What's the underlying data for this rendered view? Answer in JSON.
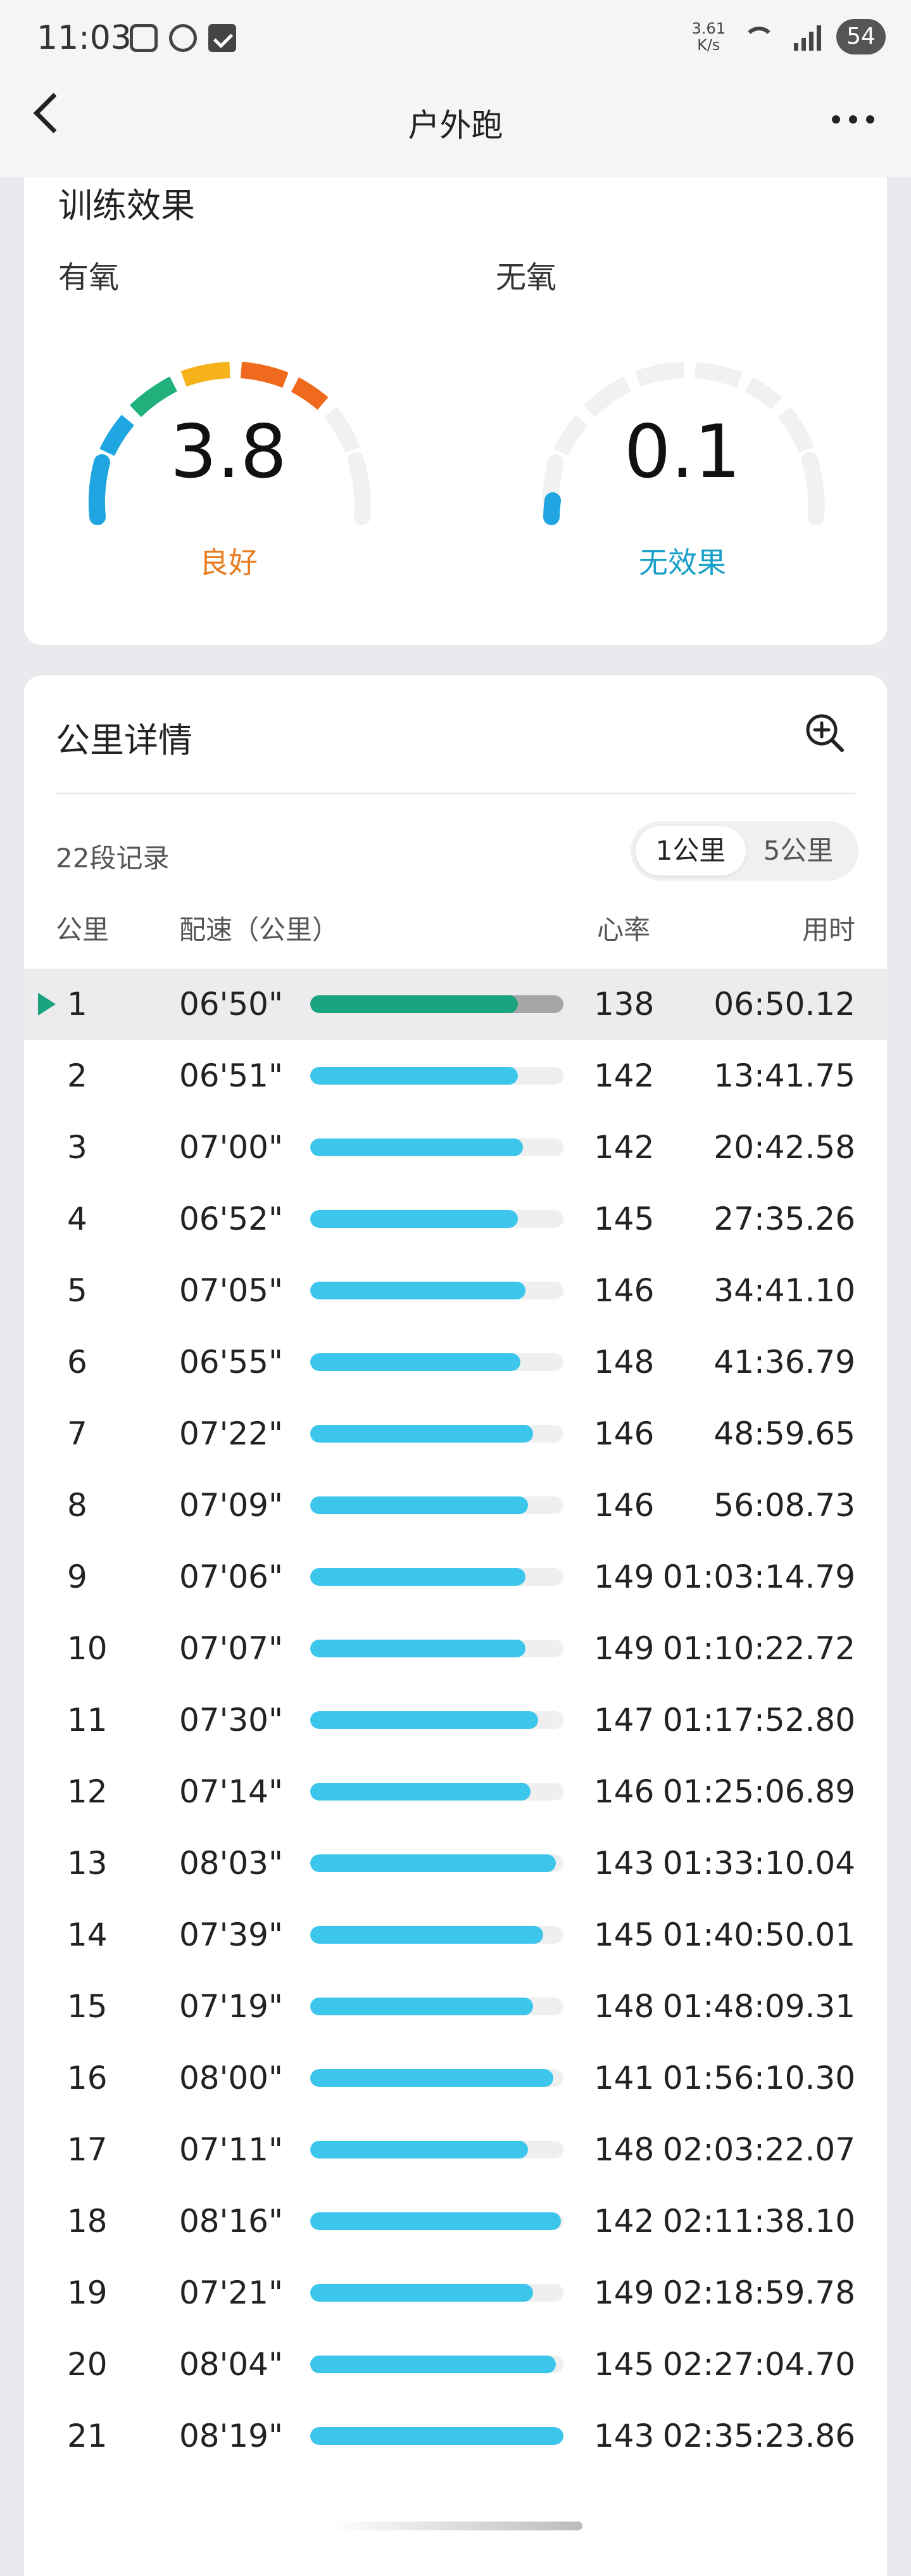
{
  "status": {
    "time": "11:03",
    "speed_value": "3.61",
    "speed_unit": "K/s",
    "battery": "54"
  },
  "header": {
    "title": "户外跑"
  },
  "training": {
    "title": "训练效果",
    "aerobic": {
      "label": "有氧",
      "value": "3.8",
      "status": "良好",
      "status_color": "#e87c1e"
    },
    "anaerobic": {
      "label": "无氧",
      "value": "0.1",
      "status": "无效果",
      "status_color": "#19a0c8"
    }
  },
  "km_details": {
    "title": "公里详情",
    "records": "22段记录",
    "toggle": {
      "active": "1公里",
      "inactive": "5公里"
    },
    "columns": {
      "km": "公里",
      "pace": "配速（公里）",
      "hr": "心率",
      "time": "用时"
    },
    "colors": {
      "first_fill": "#19a37f",
      "fill": "#3cc6ec"
    },
    "rows": [
      {
        "km": "1",
        "pace": "06'50\"",
        "pct": 0.82,
        "hr": "138",
        "time": "06:50.12",
        "selected": true
      },
      {
        "km": "2",
        "pace": "06'51\"",
        "pct": 0.82,
        "hr": "142",
        "time": "13:41.75"
      },
      {
        "km": "3",
        "pace": "07'00\"",
        "pct": 0.84,
        "hr": "142",
        "time": "20:42.58"
      },
      {
        "km": "4",
        "pace": "06'52\"",
        "pct": 0.82,
        "hr": "145",
        "time": "27:35.26"
      },
      {
        "km": "5",
        "pace": "07'05\"",
        "pct": 0.85,
        "hr": "146",
        "time": "34:41.10"
      },
      {
        "km": "6",
        "pace": "06'55\"",
        "pct": 0.83,
        "hr": "148",
        "time": "41:36.79"
      },
      {
        "km": "7",
        "pace": "07'22\"",
        "pct": 0.88,
        "hr": "146",
        "time": "48:59.65"
      },
      {
        "km": "8",
        "pace": "07'09\"",
        "pct": 0.86,
        "hr": "146",
        "time": "56:08.73"
      },
      {
        "km": "9",
        "pace": "07'06\"",
        "pct": 0.85,
        "hr": "149",
        "time": "01:03:14.79"
      },
      {
        "km": "10",
        "pace": "07'07\"",
        "pct": 0.85,
        "hr": "149",
        "time": "01:10:22.72"
      },
      {
        "km": "11",
        "pace": "07'30\"",
        "pct": 0.9,
        "hr": "147",
        "time": "01:17:52.80"
      },
      {
        "km": "12",
        "pace": "07'14\"",
        "pct": 0.87,
        "hr": "146",
        "time": "01:25:06.89"
      },
      {
        "km": "13",
        "pace": "08'03\"",
        "pct": 0.97,
        "hr": "143",
        "time": "01:33:10.04"
      },
      {
        "km": "14",
        "pace": "07'39\"",
        "pct": 0.92,
        "hr": "145",
        "time": "01:40:50.01"
      },
      {
        "km": "15",
        "pace": "07'19\"",
        "pct": 0.88,
        "hr": "148",
        "time": "01:48:09.31"
      },
      {
        "km": "16",
        "pace": "08'00\"",
        "pct": 0.96,
        "hr": "141",
        "time": "01:56:10.30"
      },
      {
        "km": "17",
        "pace": "07'11\"",
        "pct": 0.86,
        "hr": "148",
        "time": "02:03:22.07"
      },
      {
        "km": "18",
        "pace": "08'16\"",
        "pct": 0.99,
        "hr": "142",
        "time": "02:11:38.10"
      },
      {
        "km": "19",
        "pace": "07'21\"",
        "pct": 0.88,
        "hr": "149",
        "time": "02:18:59.78"
      },
      {
        "km": "20",
        "pace": "08'04\"",
        "pct": 0.97,
        "hr": "145",
        "time": "02:27:04.70"
      },
      {
        "km": "21",
        "pace": "08'19\"",
        "pct": 1.0,
        "hr": "143",
        "time": "02:35:23.86"
      }
    ]
  }
}
